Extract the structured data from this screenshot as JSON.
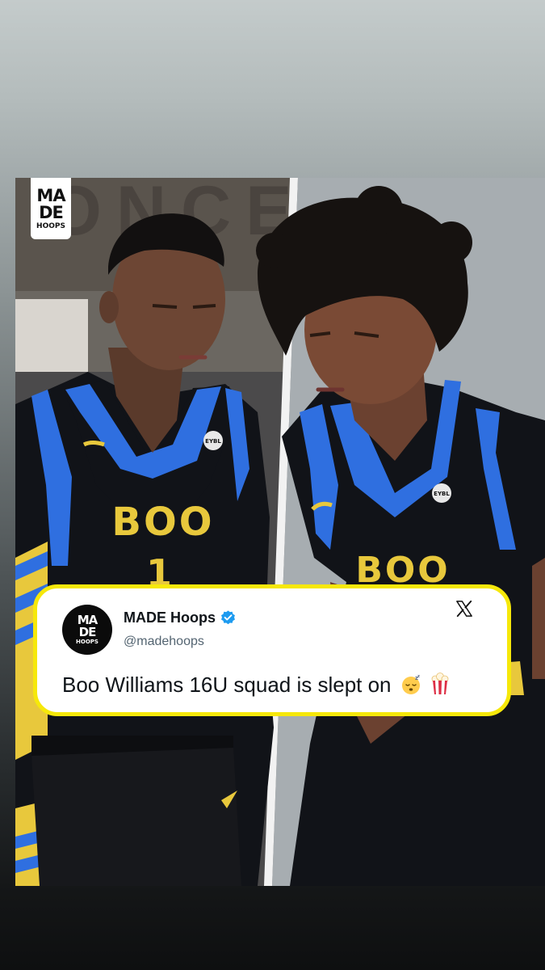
{
  "post": {
    "logo": {
      "line1": "MA",
      "line2": "DE",
      "line3": "HOOPS"
    },
    "jersey_left": {
      "team": "BOO",
      "number": "1",
      "patch": "EYBL"
    },
    "jersey_right": {
      "team": "BOO",
      "patch": "EYBL"
    },
    "background_sign": "ONCE",
    "colors": {
      "jersey": "#111318",
      "trim": "#2f6fe0",
      "lettering": "#e8c83c",
      "accent_border": "#f6e80a"
    }
  },
  "tweet": {
    "avatar": {
      "line1": "MA",
      "line2": "DE",
      "line3": "HOOPS"
    },
    "author": "MADE Hoops",
    "handle": "@madehoops",
    "text": "Boo Williams 16U squad is slept on",
    "emojis": [
      "sleeping-face",
      "popcorn"
    ],
    "icons": [
      "verified-badge-icon",
      "x-logo-icon"
    ]
  }
}
